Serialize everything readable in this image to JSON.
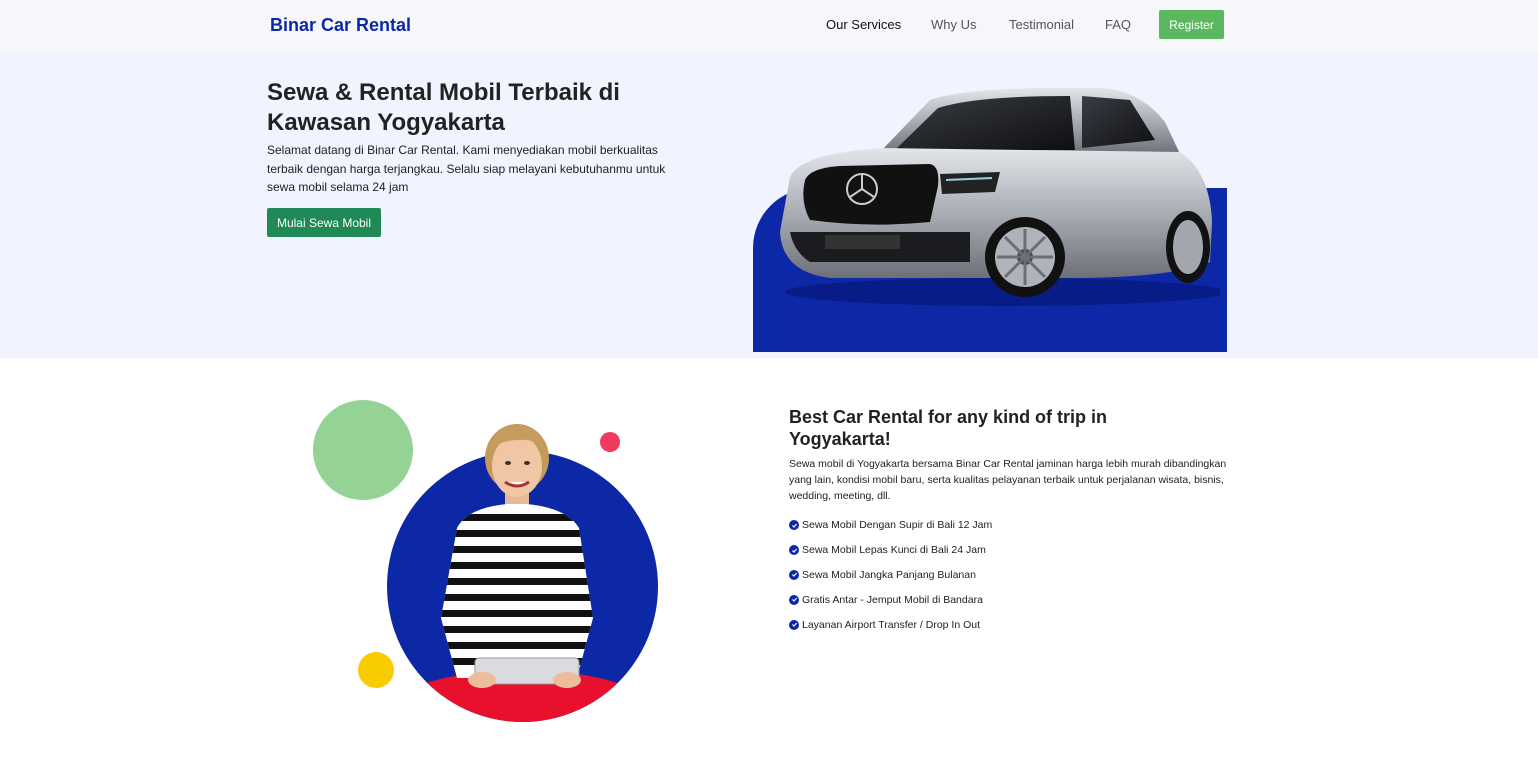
{
  "navbar": {
    "brand": "Binar Car Rental",
    "links": [
      "Our Services",
      "Why Us",
      "Testimonial",
      "FAQ"
    ],
    "register_label": "Register"
  },
  "hero": {
    "title": "Sewa & Rental Mobil Terbaik di Kawasan Yogyakarta",
    "description": "Selamat datang di Binar Car Rental. Kami menyediakan mobil berkualitas terbaik dengan harga terjangkau. Selalu siap melayani kebutuhanmu untuk sewa mobil selama 24 jam",
    "cta_label": "Mulai Sewa Mobil"
  },
  "why": {
    "title": "Best Car Rental for any kind of trip in Yogyakarta!",
    "description": "Sewa mobil di Yogyakarta bersama Binar Car Rental jaminan harga lebih murah dibandingkan yang lain, kondisi mobil baru, serta kualitas pelayanan terbaik untuk perjalanan wisata, bisnis, wedding, meeting, dll.",
    "items": [
      "Sewa Mobil Dengan Supir di Bali 12 Jam",
      "Sewa Mobil Lepas Kunci di Bali 24 Jam",
      "Sewa Mobil Jangka Panjang Bulanan",
      "Gratis Antar - Jemput Mobil di Bandara",
      "Layanan Airport Transfer / Drop In Out"
    ]
  },
  "colors": {
    "brand_blue": "#0d28a6",
    "register_green": "#5cb85f",
    "cta_green": "#1f8a56",
    "hero_bg": "#f1f3ff"
  },
  "icons": [
    "car-image",
    "woman-image",
    "check-circle-icon"
  ]
}
